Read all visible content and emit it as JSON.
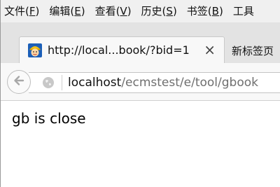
{
  "menubar": {
    "items": [
      {
        "label": "文件(",
        "key": "F",
        "suffix": ")"
      },
      {
        "label": "编辑(",
        "key": "E",
        "suffix": ")"
      },
      {
        "label": "查看(",
        "key": "V",
        "suffix": ")"
      },
      {
        "label": "历史(",
        "key": "S",
        "suffix": ")"
      },
      {
        "label": "书签(",
        "key": "B",
        "suffix": ")"
      },
      {
        "label": "工具",
        "key": "",
        "suffix": ""
      }
    ]
  },
  "tabs": {
    "active_title": "http://local...book/?bid=1",
    "close_symbol": "×",
    "new_tab_label": "新标签页"
  },
  "navbar": {
    "url_host": "localhost",
    "url_path": "/ecmstest/e/tool/gbook"
  },
  "content": {
    "text": "gb is close"
  },
  "colors": {
    "menubar_bg": "#f0f0f0",
    "tabstrip_bg": "#e3e3e3",
    "url_path": "#6f6f6f"
  },
  "icons": {
    "favicon": "smiley-helmet-favicon",
    "back": "back-arrow-icon",
    "identity": "globe-icon",
    "close": "close-icon"
  }
}
